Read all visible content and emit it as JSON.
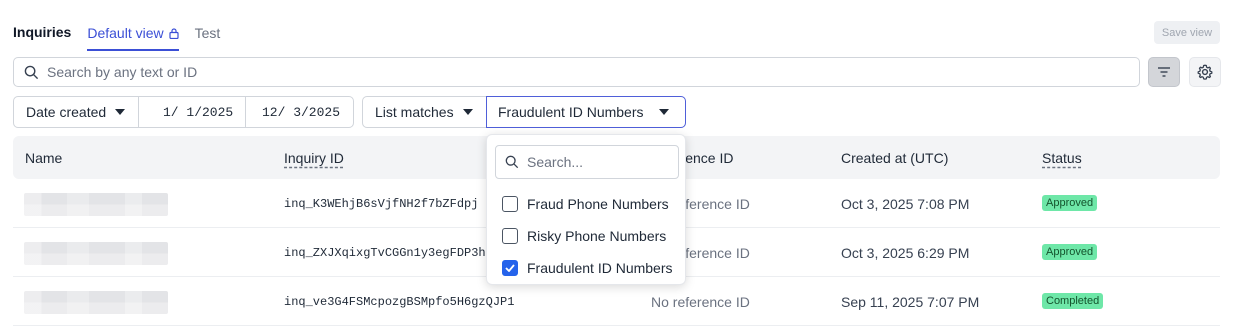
{
  "header": {
    "title": "Inquiries",
    "tabs": [
      {
        "label": "Default view"
      },
      {
        "label": "Test"
      }
    ],
    "save_view_label": "Save view"
  },
  "search": {
    "placeholder": "Search by any text or ID"
  },
  "filters": {
    "date_field": "Date created",
    "date_from": "1/ 1/2025",
    "date_to": "12/ 3/2025",
    "list_field": "List matches",
    "list_value": "Fraudulent ID Numbers"
  },
  "dropdown": {
    "search_placeholder": "Search...",
    "options": [
      {
        "label": "Fraud Phone Numbers",
        "checked": false
      },
      {
        "label": "Risky Phone Numbers",
        "checked": false
      },
      {
        "label": "Fraudulent ID Numbers",
        "checked": true
      }
    ]
  },
  "table": {
    "columns": [
      "Name",
      "Inquiry ID",
      "Reference ID",
      "Created at (UTC)",
      "Status"
    ],
    "rows": [
      {
        "inquiry_id": "inq_K3WEhjB6sVjfNH2f7bZFdpj",
        "reference_id": "No reference ID",
        "created_at": "Oct 3, 2025 7:08 PM",
        "status": "Approved"
      },
      {
        "inquiry_id": "inq_ZXJXqixgTvCGGn1y3egFDP3h",
        "reference_id": "No reference ID",
        "created_at": "Oct 3, 2025 6:29 PM",
        "status": "Approved"
      },
      {
        "inquiry_id": "inq_ve3G4FSMcpozgBSMpfo5H6gzQJP1",
        "reference_id": "No reference ID",
        "created_at": "Sep 11, 2025 7:07 PM",
        "status": "Completed"
      }
    ]
  },
  "colors": {
    "accent": "#3b4fd6",
    "status_green": "#6ee7a8",
    "checkbox_blue": "#2563eb"
  }
}
